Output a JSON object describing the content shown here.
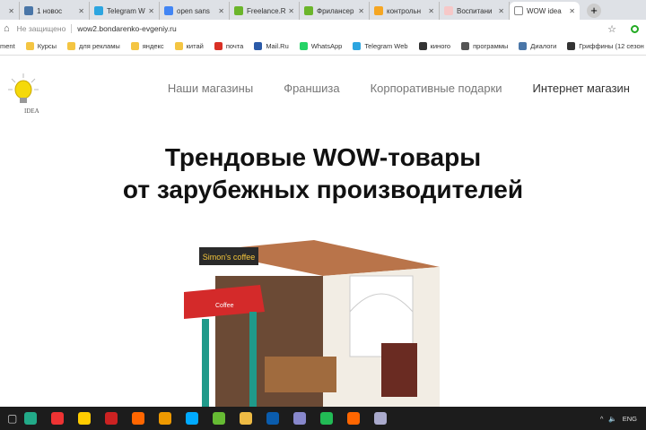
{
  "browser": {
    "tabs": [
      {
        "label": "",
        "color": "#999"
      },
      {
        "label": "1 новос",
        "color": "#4a76a8"
      },
      {
        "label": "Telegram W",
        "color": "#2ca5e0"
      },
      {
        "label": "open sans",
        "color": "#4285f4"
      },
      {
        "label": "Freelance.R",
        "color": "#6bb52b"
      },
      {
        "label": "Фрилансер",
        "color": "#6bb52b"
      },
      {
        "label": "контрольн",
        "color": "#f5a623"
      },
      {
        "label": "Воспитани",
        "color": "#f6c8c8"
      },
      {
        "label": "WOW idea",
        "color": "#fff",
        "active": true
      }
    ],
    "new_tab": "+",
    "security": "Не защищено",
    "url": "wow2.bondarenko-evgeniy.ru",
    "bookmarks": [
      {
        "label": "ment",
        "color": ""
      },
      {
        "label": "Курсы",
        "color": "#f4c542"
      },
      {
        "label": "для рекламы",
        "color": "#f4c542"
      },
      {
        "label": "яндекс",
        "color": "#f4c542"
      },
      {
        "label": "китай",
        "color": "#f4c542"
      },
      {
        "label": "почта",
        "color": "#d93025"
      },
      {
        "label": "Mail.Ru",
        "color": "#2b5aa8"
      },
      {
        "label": "WhatsApp",
        "color": "#25d366"
      },
      {
        "label": "Telegram Web",
        "color": "#2ca5e0"
      },
      {
        "label": "киного",
        "color": "#333"
      },
      {
        "label": "программы",
        "color": "#555"
      },
      {
        "label": "Диалоги",
        "color": "#4a76a8"
      },
      {
        "label": "Гриффины (12 сезон",
        "color": "#333"
      }
    ]
  },
  "site": {
    "logo_text": "IDEA",
    "nav": [
      "Наши магазины",
      "Франшиза",
      "Корпоративные подарки",
      "Интернет магазин"
    ],
    "hero_line1": "Трендовые WOW-товары",
    "hero_line2": "от зарубежных производителей",
    "product_sign": "Simon's coffee",
    "awning_text": "Coffee"
  },
  "taskbar": {
    "apps": [
      "#2a8",
      "#e33",
      "#fc0",
      "#c22",
      "#f60",
      "#e90",
      "#0af",
      "#6b3",
      "#eb4",
      "#0a5cad",
      "#88c",
      "#2b5",
      "#f60",
      "#aac"
    ],
    "tray": {
      "lang": "ENG"
    }
  }
}
